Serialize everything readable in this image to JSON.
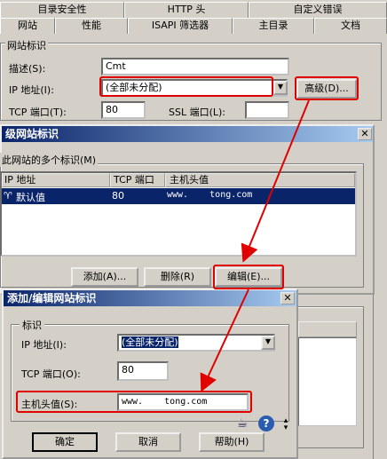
{
  "tabs_row1": [
    "目录安全性",
    "HTTP 头",
    "自定义错误"
  ],
  "tabs_row2": [
    "网站",
    "性能",
    "ISAPI 筛选器",
    "主目录",
    "文档"
  ],
  "website": {
    "group_label": "网站标识",
    "desc_label": "描述(S):",
    "desc_value": "Cmt",
    "ip_label": "IP 地址(I):",
    "ip_value": "(全部未分配)",
    "advanced_button": "高级(D)...",
    "tcp_label": "TCP 端口(T):",
    "tcp_value": "80",
    "ssl_label": "SSL 端口(L):",
    "ssl_value": ""
  },
  "advanced_dialog": {
    "title": "级网站标识",
    "group_label": "此网站的多个标识(M)",
    "columns": [
      "IP 地址",
      "TCP 端口",
      "主机头值"
    ],
    "rows": [
      {
        "ip": "默认值",
        "port": "80",
        "host": "www.    tong.com"
      }
    ],
    "add_button": "添加(A)...",
    "remove_button": "删除(R)",
    "edit_button": "编辑(E)..."
  },
  "edit_dialog": {
    "title": "添加/编辑网站标识",
    "group_label": "标识",
    "ip_label": "IP 地址(I):",
    "ip_value": "(全部未分配)",
    "tcp_label": "TCP 端口(O):",
    "tcp_value": "80",
    "host_label": "主机头值(S):",
    "host_value": "www.    tong.com",
    "ok_button": "确定",
    "cancel_button": "取消",
    "help_button": "帮助(H)"
  },
  "accent_colors": {
    "highlight": "#e00000",
    "titlebar": "#0a246a",
    "selection": "#0a246a"
  }
}
